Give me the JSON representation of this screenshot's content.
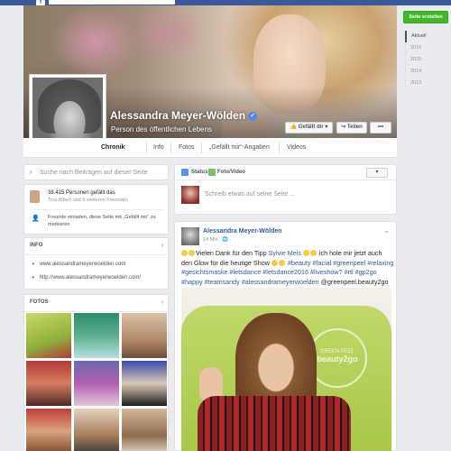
{
  "profile": {
    "name": "Alessandra Meyer-Wölden",
    "subtitle": "Person des öffentlichen Lebens",
    "like_button": "Gefällt dir",
    "message_button": "Teilen",
    "more_button": "•••"
  },
  "tabs": [
    {
      "label": "Chronik",
      "active": true
    },
    {
      "label": "Info"
    },
    {
      "label": "Fotos"
    },
    {
      "label": "„Gefällt mir“-Angaben"
    },
    {
      "label": "Videos"
    }
  ],
  "left": {
    "search_placeholder": "Suche nach Beiträgen auf dieser Seite",
    "likes_count": "38.415 Personen gefällt das",
    "likes_friends": "Tina Albert und 9 weiteren Freunden",
    "invite_text": "Freunde einladen, diese Seite mit „Gefällt mir“ zu markieren",
    "info_title": "INFO",
    "links": [
      "www.alessandrameyerwoelden.com",
      "http://www.alessandrameyerwoelden.com/"
    ],
    "photos_title": "FOTOS"
  },
  "composer": {
    "status_label": "Status",
    "photo_label": "Foto/Video",
    "placeholder": "Schreib etwas auf seine Seite ..."
  },
  "post": {
    "author": "Alessandra Meyer-Wölden",
    "time": "14 Min · ",
    "text_1": "Vielen Dank für den Tipp ",
    "mention": "Sylvie Meis",
    "text_2": " ich hole mir jetzt auch den Glow für die heutige Show",
    "hashtags_1": " #beauty #facial #greenpeel #relaxing #gesichtsmaske #letsdance #letsdance2016 #liveshow? #rtl #gp2go #happy #teamsandy #alessandrameyerwoelden",
    "text_3": " @greenpeel.beauty2go",
    "photo_logo_top": "GREEN PEEL",
    "photo_logo_main": "beauty2go"
  },
  "sidebar": {
    "create_page": "Seite erstellen",
    "timeline": [
      "Aktuell",
      "2016",
      "2015",
      "2014",
      "2013"
    ]
  },
  "colors": {
    "brand": "#3b5998",
    "link": "#365899",
    "create_green": "#42b72a",
    "verified": "#4c8ef6"
  }
}
